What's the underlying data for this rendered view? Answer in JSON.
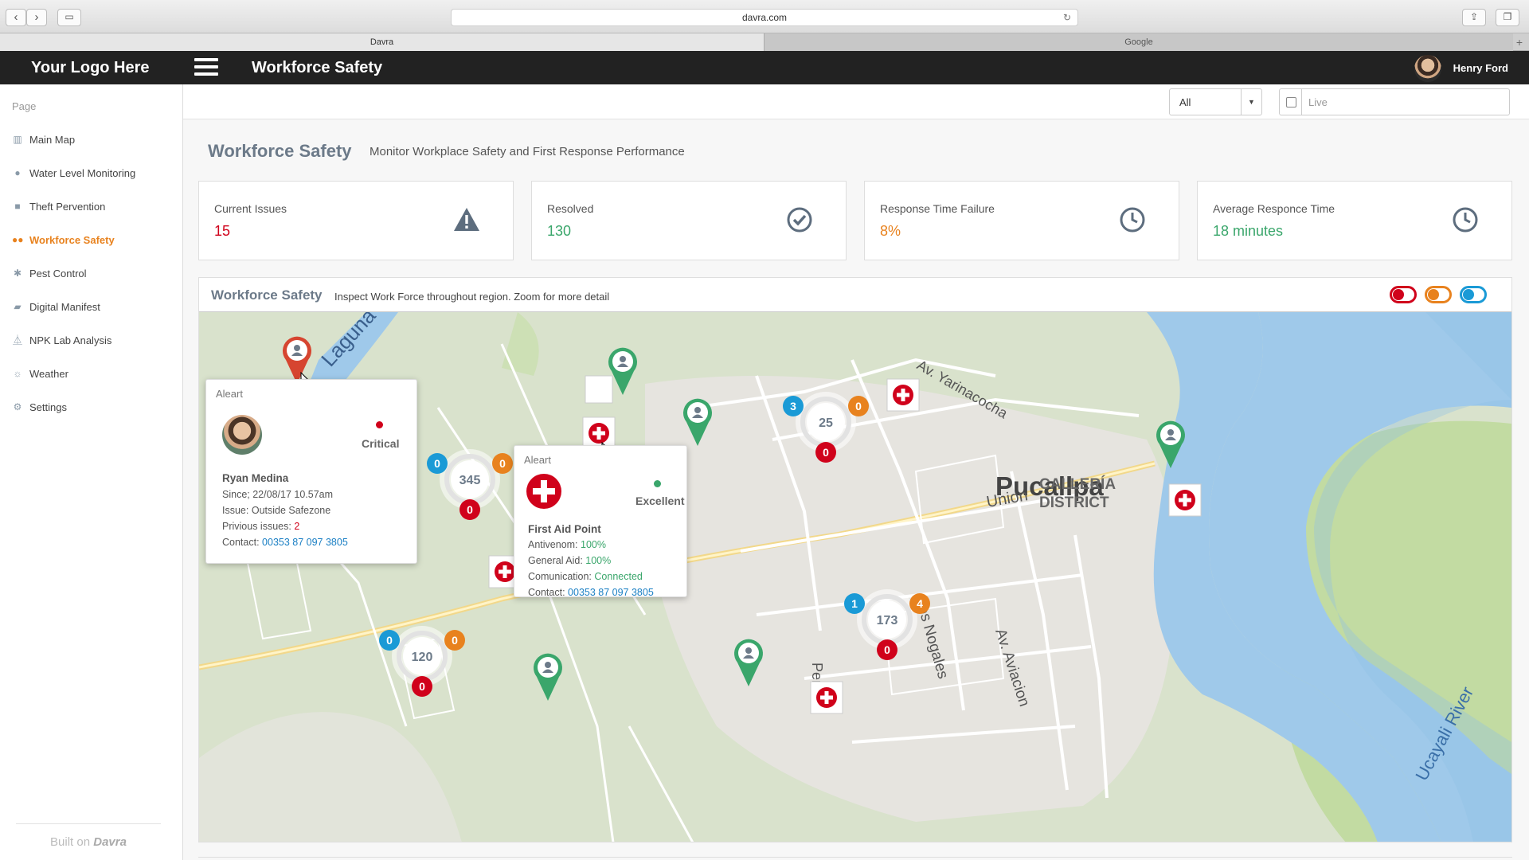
{
  "browser": {
    "url": "davra.com",
    "tabs": [
      {
        "label": "Davra",
        "active": true
      },
      {
        "label": "Google",
        "active": false
      }
    ]
  },
  "header": {
    "logo": "Your Logo Here",
    "title": "Workforce Safety",
    "user_name": "Henry Ford"
  },
  "sidebar": {
    "heading": "Page",
    "items": [
      {
        "label": "Main Map",
        "icon": "map-icon"
      },
      {
        "label": "Water Level Monitoring",
        "icon": "drop-icon"
      },
      {
        "label": "Theft Pervention",
        "icon": "lock-icon"
      },
      {
        "label": "Workforce Safety",
        "icon": "users-icon",
        "active": true
      },
      {
        "label": "Pest Control",
        "icon": "bug-icon"
      },
      {
        "label": "Digital Manifest",
        "icon": "truck-icon"
      },
      {
        "label": "NPK Lab Analysis",
        "icon": "flask-icon"
      },
      {
        "label": "Weather",
        "icon": "sun-icon"
      },
      {
        "label": "Settings",
        "icon": "gear-icon"
      }
    ],
    "built_on": "Built on",
    "built_on_brand": "Davra"
  },
  "filters": {
    "select_value": "All",
    "date_placeholder": "Live"
  },
  "page": {
    "title": "Workforce Safety",
    "subtitle": "Monitor Workplace Safety and First Response Performance"
  },
  "stats": [
    {
      "label": "Current Issues",
      "value": "15",
      "color": "#d0021b",
      "icon": "warning-icon"
    },
    {
      "label": "Resolved",
      "value": "130",
      "color": "#3aa66b",
      "icon": "check-circle-icon"
    },
    {
      "label": "Response Time Failure",
      "value": "8%",
      "color": "#e8821e",
      "icon": "clock-icon"
    },
    {
      "label": "Average Responce Time",
      "value": "18 minutes",
      "color": "#3aa66b",
      "icon": "clock-icon"
    }
  ],
  "map": {
    "title": "Workforce Safety",
    "subtitle": "Inspect Work Force throughout region. Zoom for more detail",
    "toggles": [
      {
        "color": "#d0021b",
        "state": "on"
      },
      {
        "color": "#e8821e",
        "state": "on"
      },
      {
        "color": "#1a9ad6",
        "state": "on"
      }
    ],
    "place_labels": {
      "city": "Pucallpa",
      "district_line1": "CALLERÍA",
      "district_line2": "DISTRICT",
      "lagoon": "Laguna",
      "street1": "Av. Yarinacocha",
      "street2": "Union",
      "street3": "Los Nogales",
      "street4": "Av. Aviacion",
      "street5": "Peru",
      "river": "Ucayali River"
    },
    "clusters": [
      {
        "total": "345",
        "blue": "0",
        "orange": "0",
        "red": "0"
      },
      {
        "total": "25",
        "blue": "3",
        "orange": "0",
        "red": "0"
      },
      {
        "total": "120",
        "blue": "0",
        "orange": "0",
        "red": "0"
      },
      {
        "total": "173",
        "blue": "1",
        "orange": "4",
        "red": "0"
      }
    ],
    "alert_popup": {
      "header": "Aleart",
      "status": "Critical",
      "status_color": "#d0021b",
      "name": "Ryan Medina",
      "since_label": "Since;",
      "since_value": "22/08/17 10.57am",
      "issue_label": "Issue:",
      "issue_value": "Outside Safezone",
      "previous_label": "Privious issues:",
      "previous_value": "2",
      "contact_label": "Contact:",
      "contact_value": "00353 87 097 3805"
    },
    "aid_popup": {
      "header": "Aleart",
      "status": "Excellent",
      "status_color": "#3aa66b",
      "name": "First Aid Point",
      "antivenom_label": "Antivenom:",
      "antivenom_value": "100%",
      "general_label": "General Aid:",
      "general_value": "100%",
      "comm_label": "Comunication:",
      "comm_value": "Connected",
      "contact_label": "Contact:",
      "contact_value": "00353 87 097 3805"
    }
  }
}
